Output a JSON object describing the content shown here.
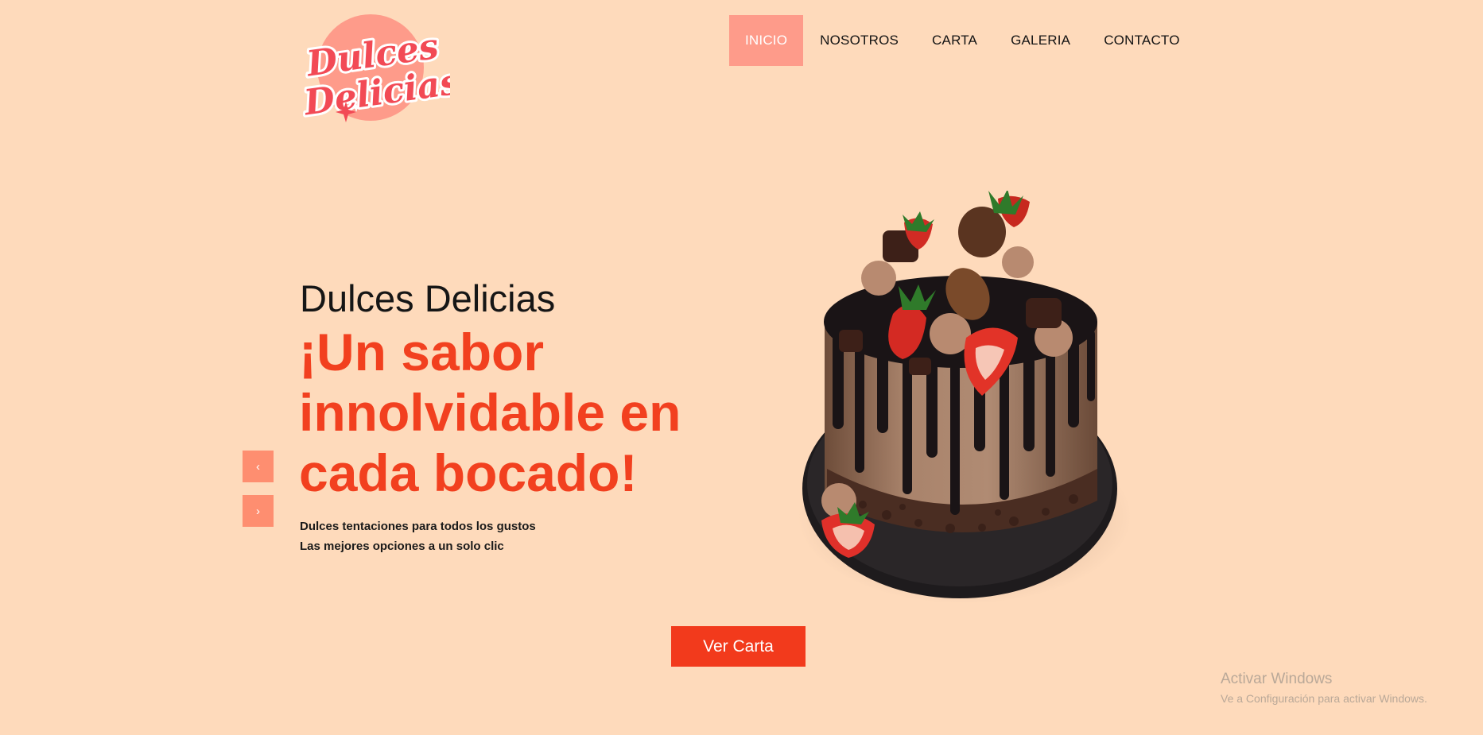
{
  "brand": {
    "logo_line1": "Dulces",
    "logo_line2": "Delicias"
  },
  "nav": {
    "items": [
      {
        "label": "INICIO",
        "active": true
      },
      {
        "label": "NOSOTROS",
        "active": false
      },
      {
        "label": "CARTA",
        "active": false
      },
      {
        "label": "GALERIA",
        "active": false
      },
      {
        "label": "CONTACTO",
        "active": false
      }
    ]
  },
  "hero": {
    "subtitle": "Dulces Delicias",
    "title": "¡Un sabor innolvidable en cada bocado!",
    "line1": "Dulces tentaciones para todos los gustos",
    "line2": "Las mejores opciones a un solo clic",
    "prev_icon": "‹",
    "next_icon": "›",
    "cta_label": "Ver Carta"
  },
  "watermark": {
    "title": "Activar Windows",
    "subtitle": "Ve a Configuración para activar Windows."
  },
  "colors": {
    "background": "#FEDABB",
    "accent": "#F2401F",
    "nav_active": "#FE9B8A",
    "slider_button": "#FE8E70",
    "logo_circle": "#FE9B8A",
    "logo_text": "#F24A55"
  },
  "icons": {
    "prev": "chevron-left-icon",
    "next": "chevron-right-icon",
    "sparkle": "sparkle-icon"
  }
}
